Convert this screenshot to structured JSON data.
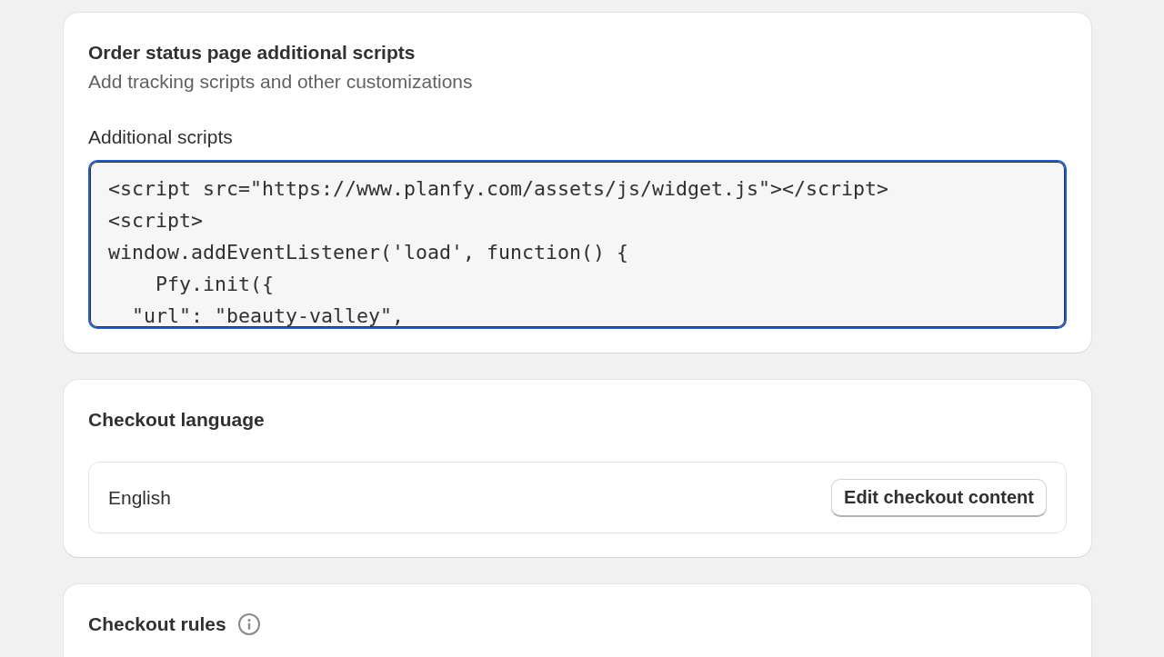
{
  "cards": [
    {
      "kind": "scripts",
      "title": "Order status page additional scripts",
      "subtitle": "Add tracking scripts and other customizations",
      "field": {
        "label": "Additional scripts",
        "focused": true,
        "value": "<script src=\"https://www.planfy.com/assets/js/widget.js\"></script>\n<script>\nwindow.addEventListener('load', function() {\n    Pfy.init({\n  \"url\": \"beauty-valley\","
      }
    },
    {
      "kind": "language",
      "title": "Checkout language",
      "language": "English",
      "button": "Edit checkout content"
    },
    {
      "kind": "rules",
      "title": "Checkout rules",
      "info": true
    }
  ]
}
